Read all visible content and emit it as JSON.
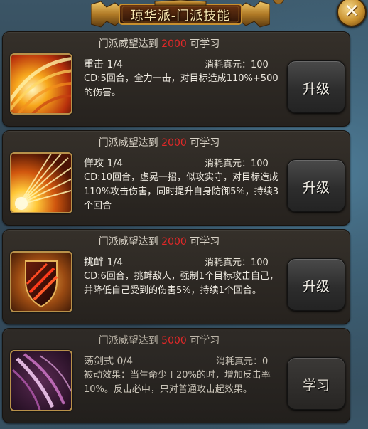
{
  "window": {
    "title": "琼华派-门派技能",
    "close_symbol": "✕"
  },
  "skills": [
    {
      "requirement_prefix": "门派威望达到",
      "requirement_value": "2000",
      "requirement_suffix": "可学习",
      "name": "重击 1/4",
      "cost": "消耗真元：100",
      "description": "CD:5回合，全力一击，对目标造成110%+500的伤害。",
      "button": "升级",
      "icon": "heavy-strike-icon"
    },
    {
      "requirement_prefix": "门派威望达到",
      "requirement_value": "2000",
      "requirement_suffix": "可学习",
      "name": "佯攻 1/4",
      "cost": "消耗真元：100",
      "description": "CD:10回合，虚晃一招，似攻实守，对目标造成110%攻击伤害，同时提升自身防御5%，持续3个回合",
      "button": "升级",
      "icon": "feint-icon"
    },
    {
      "requirement_prefix": "门派威望达到",
      "requirement_value": "2000",
      "requirement_suffix": "可学习",
      "name": "挑衅 1/4",
      "cost": "消耗真元：100",
      "description": "CD:6回合，挑衅敌人，强制1个目标攻击自己，并降低自己受到的伤害5%，持续1个回合。",
      "button": "升级",
      "icon": "taunt-shield-icon"
    },
    {
      "requirement_prefix": "门派威望达到",
      "requirement_value": "5000",
      "requirement_suffix": "可学习",
      "name": "荡剑式 0/4",
      "cost": "消耗真元：0",
      "description": "被动效果：当生命少于20%的时，增加反击率10%。反击必中，只对普通攻击起效果。",
      "button": "学习",
      "icon": "sword-sweep-icon"
    }
  ],
  "colors": {
    "requirement_number": "#e32828",
    "banner_gold": "#c8902e"
  }
}
